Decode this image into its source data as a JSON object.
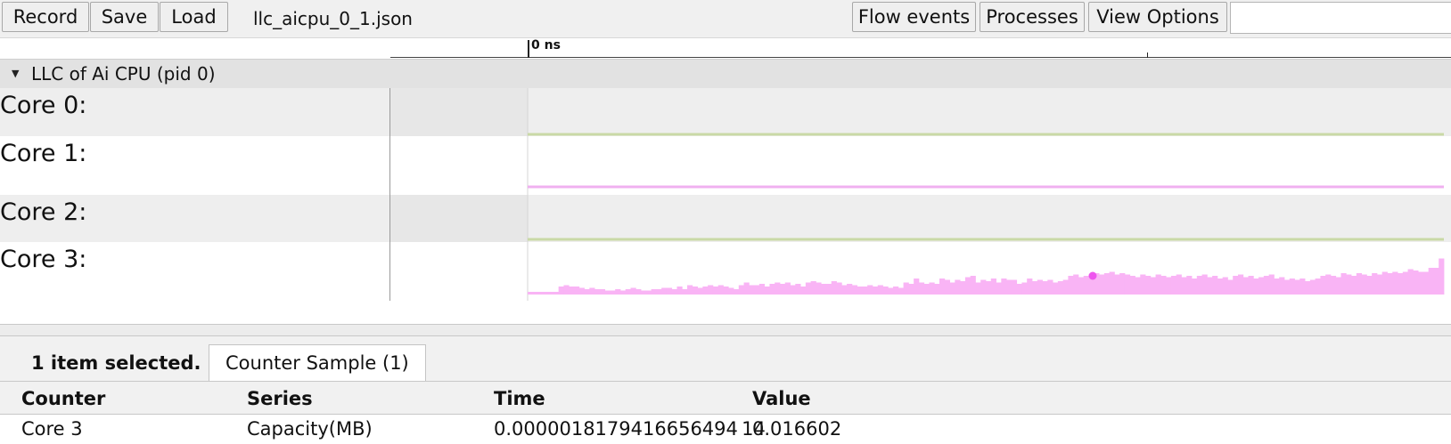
{
  "toolbar": {
    "record_label": "Record",
    "save_label": "Save",
    "load_label": "Load",
    "filename": "llc_aicpu_0_1.json",
    "flow_events_label": "Flow events",
    "processes_label": "Processes",
    "view_options_label": "View Options",
    "search_value": ""
  },
  "ruler": {
    "start_label": "0 ns"
  },
  "process": {
    "title": "LLC of Ai CPU (pid 0)"
  },
  "tracks": [
    {
      "label": "Core 0:",
      "color": "#c9d9a6"
    },
    {
      "label": "Core 1:",
      "color": "#f0b0f0"
    },
    {
      "label": "Core 2:",
      "color": "#c9d9a6"
    },
    {
      "label": "Core 3:",
      "color": "#f9b4f5"
    }
  ],
  "core3_series": [
    0.1,
    0.1,
    0.1,
    0.1,
    0.1,
    0.1,
    0.3,
    0.35,
    0.3,
    0.3,
    0.25,
    0.2,
    0.25,
    0.2,
    0.2,
    0.15,
    0.15,
    0.2,
    0.15,
    0.2,
    0.25,
    0.2,
    0.15,
    0.15,
    0.2,
    0.2,
    0.25,
    0.25,
    0.2,
    0.3,
    0.2,
    0.35,
    0.3,
    0.25,
    0.3,
    0.35,
    0.3,
    0.35,
    0.3,
    0.25,
    0.2,
    0.35,
    0.45,
    0.35,
    0.35,
    0.4,
    0.3,
    0.4,
    0.45,
    0.4,
    0.45,
    0.35,
    0.4,
    0.3,
    0.45,
    0.5,
    0.45,
    0.4,
    0.4,
    0.5,
    0.45,
    0.35,
    0.4,
    0.35,
    0.3,
    0.3,
    0.35,
    0.3,
    0.35,
    0.3,
    0.25,
    0.3,
    0.25,
    0.45,
    0.4,
    0.6,
    0.45,
    0.4,
    0.45,
    0.4,
    0.6,
    0.55,
    0.45,
    0.55,
    0.5,
    0.65,
    0.7,
    0.45,
    0.55,
    0.5,
    0.6,
    0.45,
    0.6,
    0.55,
    0.55,
    0.4,
    0.45,
    0.6,
    0.5,
    0.55,
    0.5,
    0.55,
    0.45,
    0.5,
    0.55,
    0.7,
    0.75,
    0.65,
    0.7,
    0.75,
    0.8,
    0.75,
    0.8,
    0.85,
    0.75,
    0.8,
    0.75,
    0.7,
    0.65,
    0.75,
    0.7,
    0.65,
    0.75,
    0.7,
    0.65,
    0.7,
    0.75,
    0.65,
    0.7,
    0.6,
    0.7,
    0.75,
    0.65,
    0.7,
    0.6,
    0.65,
    0.55,
    0.7,
    0.75,
    0.65,
    0.7,
    0.6,
    0.65,
    0.7,
    0.75,
    0.6,
    0.65,
    0.55,
    0.6,
    0.55,
    0.6,
    0.5,
    0.55,
    0.6,
    0.7,
    0.75,
    0.7,
    0.65,
    0.8,
    0.75,
    0.7,
    0.8,
    0.75,
    0.7,
    0.8,
    0.75,
    0.85,
    0.8,
    0.85,
    0.8,
    0.85,
    0.95,
    0.9,
    0.85,
    0.85,
    1.0,
    1.0,
    1.35
  ],
  "detail": {
    "selection_text": "1 item selected.",
    "tab_label": "Counter Sample (1)",
    "columns": {
      "counter": "Counter",
      "series": "Series",
      "time": "Time",
      "value": "Value"
    },
    "row": {
      "counter": "Core 3",
      "series": "Capacity(MB)",
      "time": "0.0000018179416656494 14",
      "value": "0.016602"
    }
  }
}
